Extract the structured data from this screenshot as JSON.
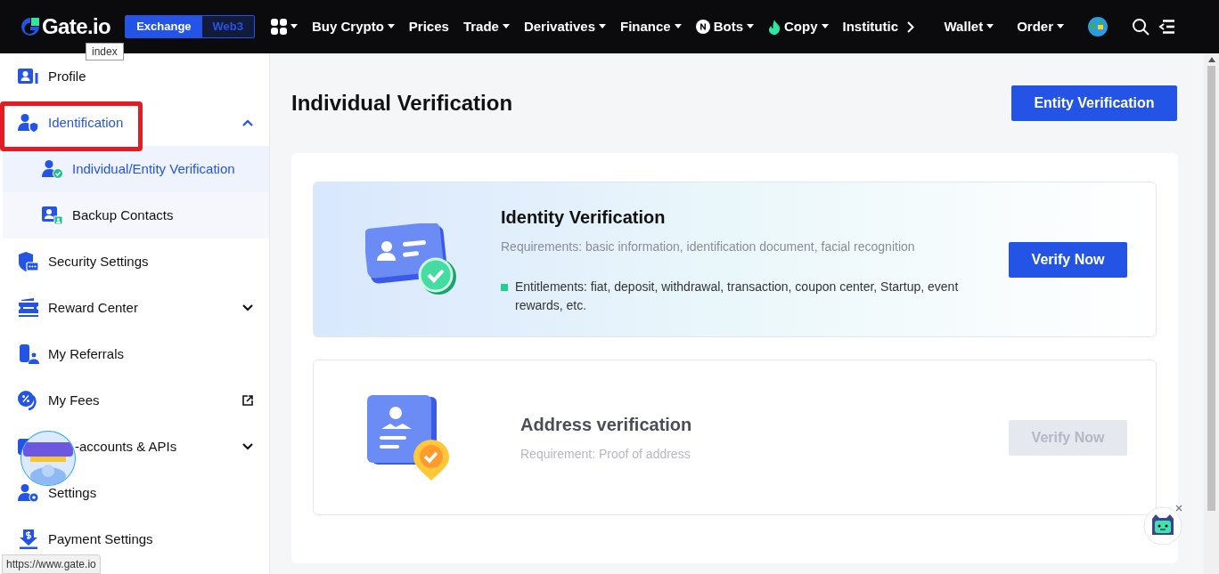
{
  "header": {
    "logo": "Gate.io",
    "logo_tooltip": "index",
    "mode_tabs": [
      {
        "label": "Exchange",
        "selected": true
      },
      {
        "label": "Web3",
        "selected": false
      }
    ],
    "nav": [
      {
        "kind": "apps",
        "caret": true
      },
      {
        "kind": "plain",
        "label": "Buy Crypto",
        "caret": true
      },
      {
        "kind": "plain",
        "label": "Prices",
        "caret": false
      },
      {
        "kind": "plain",
        "label": "Trade",
        "caret": true
      },
      {
        "kind": "plain",
        "label": "Derivatives",
        "caret": true
      },
      {
        "kind": "plain",
        "label": "Finance",
        "caret": true
      },
      {
        "kind": "bots",
        "label": "Bots",
        "caret": true
      },
      {
        "kind": "copy",
        "label": "Copy",
        "caret": true
      },
      {
        "kind": "plain",
        "label": "Institutic",
        "caret": false
      }
    ],
    "right_nav": [
      {
        "label": "Wallet",
        "caret": true
      },
      {
        "label": "Order",
        "caret": true
      }
    ]
  },
  "sidebar": {
    "items": [
      {
        "kind": "profile",
        "label": "Profile",
        "selected": false
      },
      {
        "kind": "identification",
        "label": "Identification",
        "selected": true,
        "expanded": true,
        "highlighted": true,
        "children": [
          {
            "kind": "verified",
            "label": "Individual/Entity Verification",
            "selected": true
          },
          {
            "kind": "contacts",
            "label": "Backup Contacts",
            "selected": false
          }
        ]
      },
      {
        "kind": "security",
        "label": "Security Settings",
        "selected": false
      },
      {
        "kind": "reward",
        "label": "Reward Center",
        "selected": false,
        "expanded": false
      },
      {
        "kind": "referrals",
        "label": "My Referrals",
        "selected": false
      },
      {
        "kind": "fees",
        "label": "My Fees",
        "selected": false,
        "external": true
      },
      {
        "kind": "subaccounts",
        "label": "-accounts & APIs",
        "selected": false,
        "expanded": false
      },
      {
        "kind": "settings",
        "label": "Settings",
        "selected": false
      },
      {
        "kind": "payment",
        "label": "Payment Settings",
        "selected": false
      }
    ]
  },
  "main": {
    "title": "Individual Verification",
    "entity_button": "Entity Verification",
    "cards": [
      {
        "kind": "identity",
        "title": "Identity Verification",
        "requirement": "Requirements: basic information, identification document, facial recognition",
        "entitlements": "Entitlements: fiat, deposit, withdrawal, transaction, coupon center, Startup, event rewards, etc.",
        "button": "Verify Now",
        "disabled": false
      },
      {
        "kind": "address",
        "title": "Address verification",
        "requirement": "Requirement: Proof of address",
        "button": "Verify Now",
        "disabled": true
      }
    ]
  },
  "status_url": "https://www.gate.io"
}
